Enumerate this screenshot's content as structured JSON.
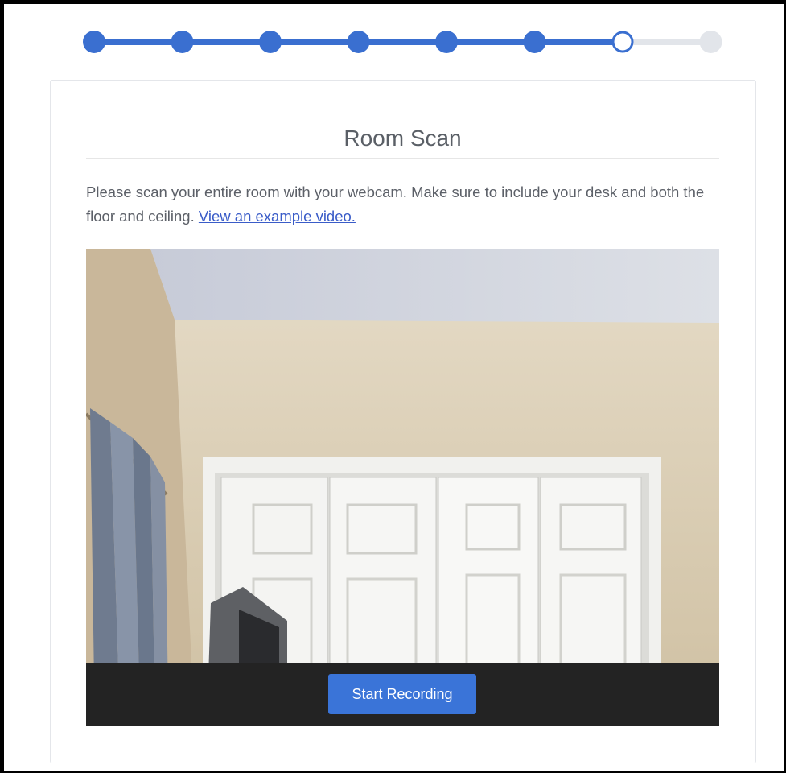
{
  "progress": {
    "total_steps": 8,
    "completed_steps": 6,
    "current_step": 7,
    "colors": {
      "active": "#3a6fd0",
      "inactive": "#e2e5ea"
    }
  },
  "page": {
    "title": "Room Scan",
    "instructions": "Please scan your entire room with your webcam. Make sure to include your desk and both the floor and ceiling. ",
    "example_link": "View an example video."
  },
  "video": {
    "record_button": "Start Recording",
    "record_button_color": "#3a74d8"
  }
}
